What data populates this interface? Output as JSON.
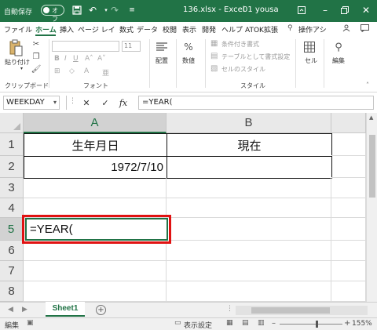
{
  "titlebar": {
    "autosave_label": "自動保存",
    "autosave_state": "オフ",
    "file_name": "136.xlsx - Excel",
    "user_name": "01 yousa"
  },
  "ribbon_tabs": [
    "ファイル",
    "ホーム",
    "挿入",
    "ページ レイ",
    "数式",
    "データ",
    "校閲",
    "表示",
    "開発",
    "ヘルプ",
    "ATOK拡張",
    "操作アシ"
  ],
  "ribbon": {
    "paste_label": "貼り付け",
    "clipboard_label": "クリップボード",
    "font_label": "フォント",
    "font_size": "11",
    "align_label": "配置",
    "number_label": "数値",
    "cond_format_label": "条件付き書式",
    "table_format_label": "テーブルとして書式設定",
    "cell_style_label": "セルのスタイル",
    "style_label": "スタイル",
    "cells_label": "セル",
    "edit_label": "編集"
  },
  "formula_bar": {
    "name_box": "WEEKDAY",
    "cancel": "✕",
    "enter": "✓",
    "fx": "fx",
    "formula": "=YEAR("
  },
  "grid": {
    "columns": [
      "A",
      "B"
    ],
    "rows": [
      "1",
      "2",
      "3",
      "4",
      "5",
      "6",
      "7",
      "8"
    ],
    "cells": {
      "A1": "生年月日",
      "B1": "現在",
      "A2": "1972/7/10",
      "B2": ""
    },
    "active_cell_content": "=YEAR("
  },
  "sheetbar": {
    "sheet_name": "Sheet1",
    "add_sheet": "+"
  },
  "statusbar": {
    "mode": "編集",
    "display_settings": "表示設定",
    "zoom": "155%"
  },
  "colors": {
    "accent": "#217346",
    "highlight": "#e01212"
  }
}
